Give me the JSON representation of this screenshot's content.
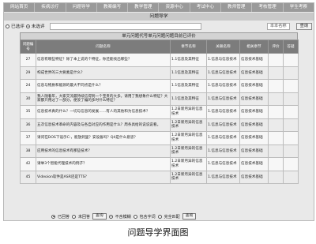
{
  "nav": [
    "网站首页",
    "疾病诊疗",
    "问题导学",
    "教案编写",
    "教学管理",
    "资源中心",
    "考试中心",
    "教师管理",
    "考核管理",
    "学生考察"
  ],
  "tab_title": "问题导学",
  "filters": {
    "opt1": "已选评",
    "opt2": "未选评",
    "course_label": "本本名称",
    "search_btn": "查询"
  },
  "table": {
    "caption": "单元问题代号单元问题问题目前已评价",
    "headers": [
      "问题编号",
      "问题名称",
      "章节名称",
      "关联名称",
      "相关章节",
      "评价",
      "答疑"
    ],
    "rows": [
      {
        "id": "27",
        "name": "信息有哪些特征？除了本上说的个特征，你还能找出哪些？",
        "sec": "1.1信息及其特征",
        "rel": "1.信息与信息技术",
        "cat": "信息技术基础"
      },
      {
        "id": "29",
        "name": "构成世界的三大要素是什么？",
        "sec": "1.1信息及其特征",
        "rel": "1.信息与信息技术",
        "cat": "信息技术基础"
      },
      {
        "id": "24",
        "name": "信息与物质和能源的最大不同点是什么？",
        "sec": "1.1信息及其特征",
        "rel": "1.信息与信息技术",
        "cat": "信息技术基础"
      },
      {
        "id": "30",
        "name": "我人随着年，大家交流最持续信得到一个宝贵的大多。请用了我想象什么特征？大家都只用过了一部分，便没了编的多时什么特征？",
        "sec": "1.1信息及其特征",
        "rel": "1.信息与信息技术",
        "cat": "信息技术基础"
      },
      {
        "id": "35",
        "name": "信息技术真的什么？一切与信息的发展……有人的其他和为信息技术？",
        "sec": "1.2日新月异的信息技术",
        "rel": "1.信息与信息技术",
        "cat": "信息技术基础"
      },
      {
        "id": "36",
        "name": "五次信息技术革命的内容及与各自对应的作用是什么？周条具给的说说说看。",
        "sec": "1.2日新月异的信息技术",
        "rel": "1.信息与信息技术",
        "cat": "信息技术基础"
      },
      {
        "id": "37",
        "name": "请问在DOS下设示C:，能放到里？安设备吗？Q4是什么意思？",
        "sec": "1.2日新月异的信息技术",
        "rel": "1.信息与信息技术",
        "cat": "信息技术基础"
      },
      {
        "id": "38",
        "name": "应用技术的信息技术有那些技术？",
        "sec": "1.2日新月异的信息技术",
        "rel": "1.信息与信息技术",
        "cat": "信息技术基础"
      },
      {
        "id": "42",
        "name": "请举3个智能代理技术的例子？",
        "sec": "1.2日新月异的信息技术",
        "rel": "1.信息与信息技术",
        "cat": "信息技术基础"
      },
      {
        "id": "45",
        "name": "Videoion软件是ASR还是TTS？",
        "sec": "1.2日新月异的信息技术",
        "rel": "1.信息与信息技术",
        "cat": "信息技术基础"
      }
    ]
  },
  "footer": {
    "opt1": "已回答",
    "opt2": "未回答",
    "btn1": "查询",
    "opt3": "不含模糊",
    "opt4": "包含字词",
    "opt5": "完全匹配",
    "btn2": "查询"
  },
  "figure_caption": "问题导学界面图"
}
